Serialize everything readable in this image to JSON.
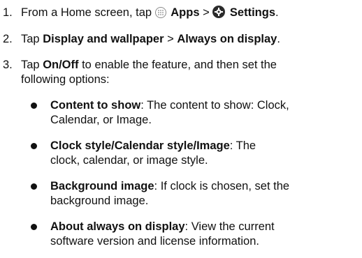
{
  "steps": [
    {
      "num": "1.",
      "parts": {
        "a": "From a Home screen, tap ",
        "apps_label": "Apps",
        "sep": " > ",
        "settings_label": "Settings",
        "end": "."
      }
    },
    {
      "num": "2.",
      "parts": {
        "a": "Tap ",
        "b1": "Display and wallpaper",
        "sep": " > ",
        "b2": "Always on display",
        "end": "."
      }
    },
    {
      "num": "3.",
      "parts": {
        "a": "Tap ",
        "b1": "On/Off",
        "line1_rest": " to enable the feature, and then set the",
        "line2": "following options:"
      }
    }
  ],
  "bullets": [
    {
      "term": "Content to show",
      "line1_rest": ": The content to show: Clock,",
      "line2": "Calendar, or Image."
    },
    {
      "term": "Clock style/Calendar style/Image",
      "line1_rest": ": The",
      "line2": "clock, calendar, or image style."
    },
    {
      "term": "Background image",
      "line1_rest": ": If clock is chosen, set the",
      "line2": "background image."
    },
    {
      "term": "About always on display",
      "line1_rest": ": View the current",
      "line2": "software version and license information."
    }
  ],
  "icons": {
    "apps": "apps-grid-icon",
    "settings": "gear-icon"
  }
}
